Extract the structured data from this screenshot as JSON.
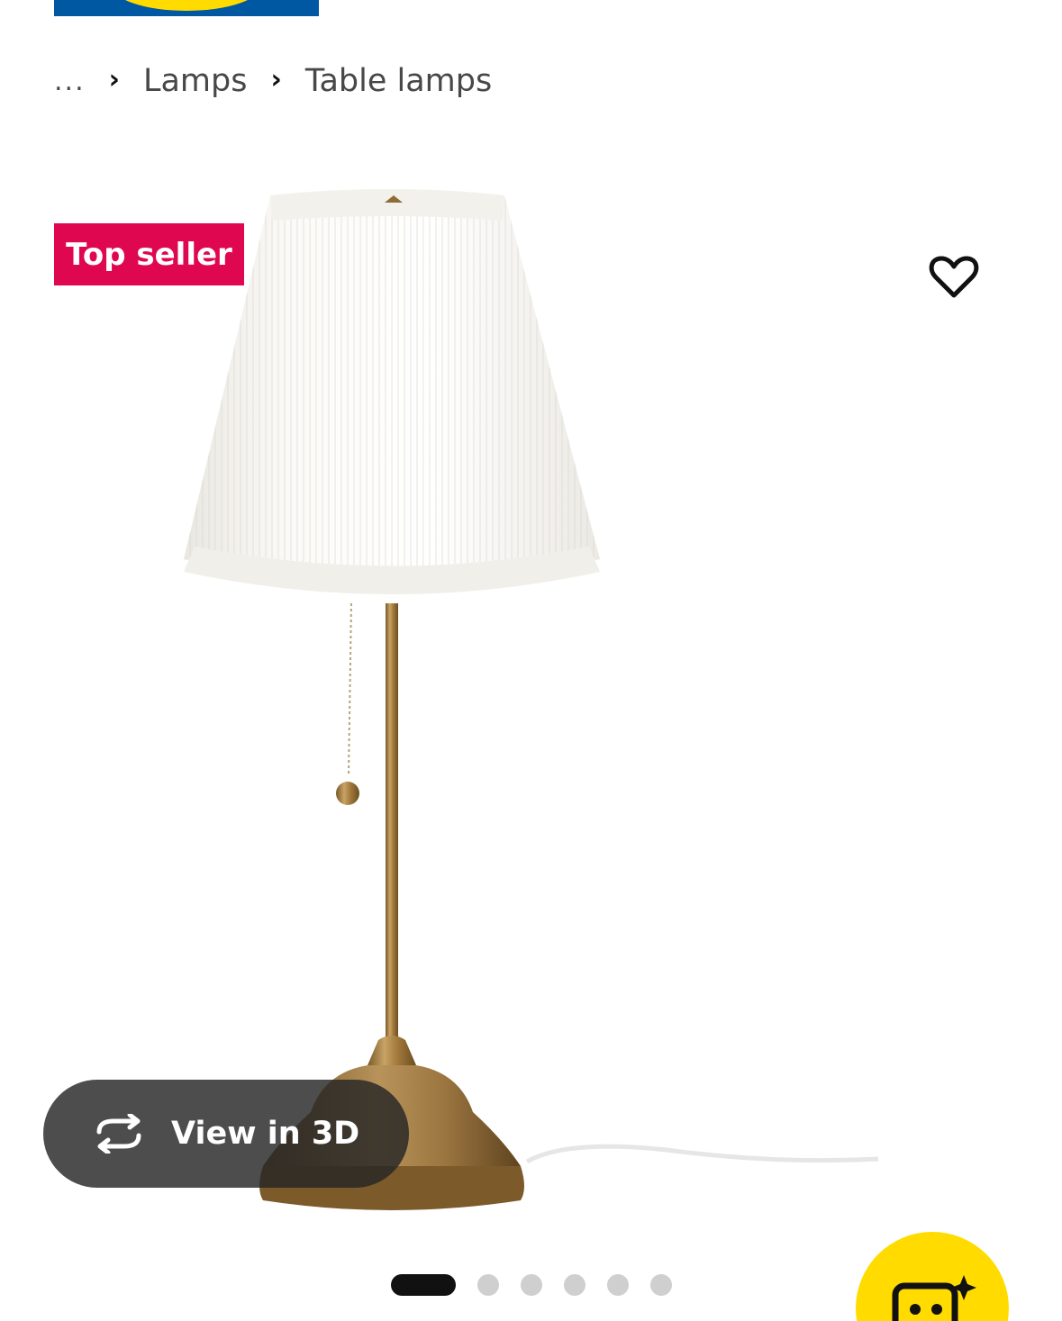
{
  "header": {
    "logo_name": "ikea-logo"
  },
  "breadcrumb": {
    "ellipsis": "...",
    "separator": "›",
    "items": [
      "Lamps",
      "Table lamps"
    ]
  },
  "product": {
    "badge": "Top seller",
    "image_name": "table-lamp-product-image"
  },
  "actions": {
    "favourite_icon": "heart-outline-icon",
    "view_3d_label": "View in 3D",
    "view_3d_icon": "rotate-3d-icon",
    "assistant_icon": "ai-camera-sparkle-icon"
  },
  "carousel": {
    "total": 6,
    "active_index": 0
  },
  "colors": {
    "badge_bg": "#e00751",
    "logo_blue": "#0058a3",
    "logo_yellow": "#ffdb00",
    "pill_bg": "#262626"
  }
}
